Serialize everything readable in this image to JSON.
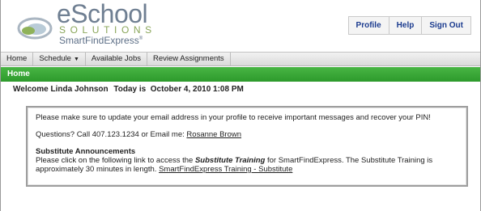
{
  "header": {
    "logo_main": "eSchool",
    "logo_sub": "SOLUTIONS",
    "logo_tagline": "SmartFindExpress",
    "logo_tm": "®",
    "nav": {
      "profile": "Profile",
      "help": "Help",
      "sign_out": "Sign Out"
    }
  },
  "menu": {
    "home": "Home",
    "schedule": "Schedule",
    "schedule_caret": "▼",
    "available_jobs": "Available Jobs",
    "review_assignments": "Review Assignments"
  },
  "page_title": "Home",
  "welcome": {
    "greeting": "Welcome Linda Johnson",
    "today": "Today is  October 4, 2010 1:08 PM"
  },
  "messages": {
    "update_email": "Please make sure to update your email address in your profile to receive important messages and recover your PIN!",
    "questions_prefix": "Questions? Call 407.123.1234 or Email me: ",
    "contact_link": "Rosanne Brown",
    "announcements_title": "Substitute Announcements",
    "ann_part1": "Please click on the following link to access the ",
    "ann_emph": "Substitute Training",
    "ann_part2": " for SmartFindExpress. The Substitute Training is approximately 30 minutes in length. ",
    "training_link": "SmartFindExpress Training - Substitute"
  },
  "colors": {
    "green_bar": "#3aa838",
    "nav_link": "#1b3b8f",
    "logo_gray": "#6f7f92",
    "logo_green": "#8aa65a"
  }
}
